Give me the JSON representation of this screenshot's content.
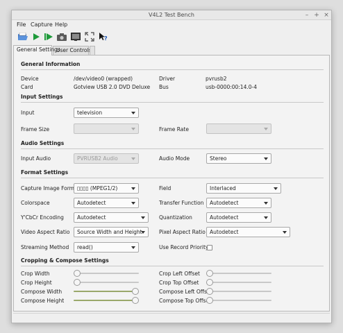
{
  "window": {
    "title": "V4L2 Test Bench",
    "controls": [
      "–",
      "+",
      "×"
    ]
  },
  "menu": {
    "file": "File",
    "capture": "Capture",
    "help": "Help"
  },
  "toolbar": {
    "icons": [
      "open-device-icon",
      "play-icon",
      "play-raw-icon",
      "snapshot-icon",
      "fullscreen-icon",
      "reset-scaling-icon",
      "whats-this-icon"
    ]
  },
  "tabs": {
    "general": "General Settings",
    "user": "User Controls"
  },
  "general_info": {
    "heading": "General Information",
    "device_label": "Device",
    "device_value": "/dev/video0 (wrapped)",
    "driver_label": "Driver",
    "driver_value": "pvrusb2",
    "card_label": "Card",
    "card_value": "Gotview USB 2.0 DVD Deluxe",
    "bus_label": "Bus",
    "bus_value": "usb-0000:00:14.0-4"
  },
  "input_settings": {
    "heading": "Input Settings",
    "input_label": "Input",
    "input_value": "television",
    "frame_size_label": "Frame Size",
    "frame_size_value": "",
    "frame_rate_label": "Frame Rate",
    "frame_rate_value": ""
  },
  "audio_settings": {
    "heading": "Audio Settings",
    "input_audio_label": "Input Audio",
    "input_audio_value": "PVRUSB2 Audio",
    "audio_mode_label": "Audio Mode",
    "audio_mode_value": "Stereo"
  },
  "format_settings": {
    "heading": "Format Settings",
    "capture_format_label": "Capture Image Formats",
    "capture_format_value": "▯▯▯▯ (MPEG1/2)",
    "field_label": "Field",
    "field_value": "Interlaced",
    "colorspace_label": "Colorspace",
    "colorspace_value": "Autodetect",
    "transfer_label": "Transfer Function",
    "transfer_value": "Autodetect",
    "ycbcr_label": "Y'CbCr Encoding",
    "ycbcr_value": "Autodetect",
    "quantization_label": "Quantization",
    "quantization_value": "Autodetect",
    "video_aspect_label": "Video Aspect Ratio",
    "video_aspect_value": "Source Width and Height",
    "pixel_aspect_label": "Pixel Aspect Ratio",
    "pixel_aspect_value": "Autodetect",
    "streaming_label": "Streaming Method",
    "streaming_value": "read()",
    "record_priority_label": "Use Record Priority",
    "record_priority_checked": false
  },
  "cropping": {
    "heading": "Cropping & Compose Settings",
    "crop_width_label": "Crop Width",
    "crop_width_level": 0,
    "crop_left_label": "Crop Left Offset",
    "crop_left_level": 0,
    "crop_height_label": "Crop Height",
    "crop_height_level": 0,
    "crop_top_label": "Crop Top Offset",
    "crop_top_level": 0,
    "compose_width_label": "Compose Width",
    "compose_width_level": 1,
    "compose_left_label": "Compose Left Offset",
    "compose_left_level": 0,
    "compose_height_label": "Compose Height",
    "compose_height_level": 1,
    "compose_top_label": "Compose Top Offset",
    "compose_top_level": 0
  }
}
